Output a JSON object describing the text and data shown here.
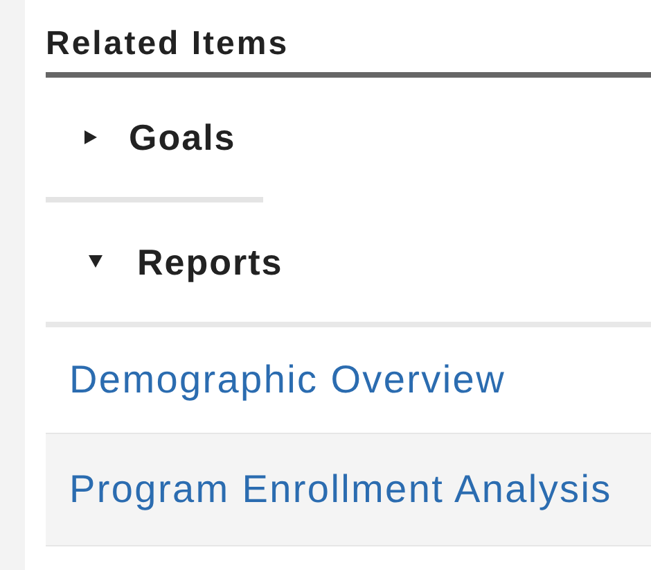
{
  "panel": {
    "title": "Related Items"
  },
  "sections": [
    {
      "label": "Goals",
      "expanded": false
    },
    {
      "label": "Reports",
      "expanded": true,
      "items": [
        {
          "label": "Demographic Overview",
          "selected": false
        },
        {
          "label": "Program Enrollment Analysis",
          "selected": true
        }
      ]
    }
  ]
}
